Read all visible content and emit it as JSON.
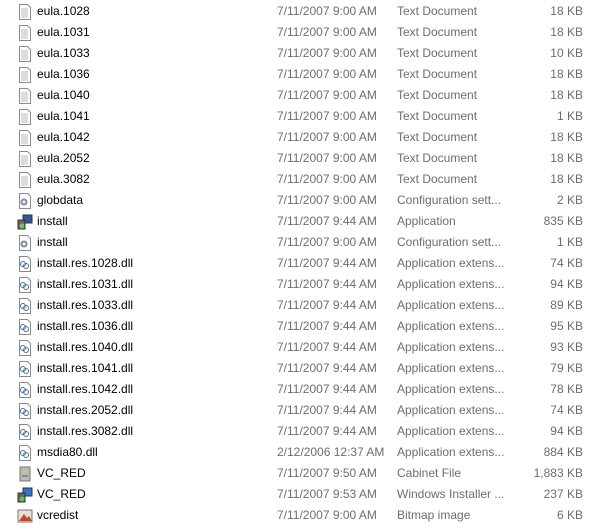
{
  "files": [
    {
      "name": "eula.1028",
      "date": "7/11/2007 9:00 AM",
      "type": "Text Document",
      "size": "18 KB",
      "icon": "text-document"
    },
    {
      "name": "eula.1031",
      "date": "7/11/2007 9:00 AM",
      "type": "Text Document",
      "size": "18 KB",
      "icon": "text-document"
    },
    {
      "name": "eula.1033",
      "date": "7/11/2007 9:00 AM",
      "type": "Text Document",
      "size": "10 KB",
      "icon": "text-document"
    },
    {
      "name": "eula.1036",
      "date": "7/11/2007 9:00 AM",
      "type": "Text Document",
      "size": "18 KB",
      "icon": "text-document"
    },
    {
      "name": "eula.1040",
      "date": "7/11/2007 9:00 AM",
      "type": "Text Document",
      "size": "18 KB",
      "icon": "text-document"
    },
    {
      "name": "eula.1041",
      "date": "7/11/2007 9:00 AM",
      "type": "Text Document",
      "size": "1 KB",
      "icon": "text-document"
    },
    {
      "name": "eula.1042",
      "date": "7/11/2007 9:00 AM",
      "type": "Text Document",
      "size": "18 KB",
      "icon": "text-document"
    },
    {
      "name": "eula.2052",
      "date": "7/11/2007 9:00 AM",
      "type": "Text Document",
      "size": "18 KB",
      "icon": "text-document"
    },
    {
      "name": "eula.3082",
      "date": "7/11/2007 9:00 AM",
      "type": "Text Document",
      "size": "18 KB",
      "icon": "text-document"
    },
    {
      "name": "globdata",
      "date": "7/11/2007 9:00 AM",
      "type": "Configuration sett...",
      "size": "2 KB",
      "icon": "config"
    },
    {
      "name": "install",
      "date": "7/11/2007 9:44 AM",
      "type": "Application",
      "size": "835 KB",
      "icon": "installer"
    },
    {
      "name": "install",
      "date": "7/11/2007 9:00 AM",
      "type": "Configuration sett...",
      "size": "1 KB",
      "icon": "config"
    },
    {
      "name": "install.res.1028.dll",
      "date": "7/11/2007 9:44 AM",
      "type": "Application extens...",
      "size": "74 KB",
      "icon": "dll"
    },
    {
      "name": "install.res.1031.dll",
      "date": "7/11/2007 9:44 AM",
      "type": "Application extens...",
      "size": "94 KB",
      "icon": "dll"
    },
    {
      "name": "install.res.1033.dll",
      "date": "7/11/2007 9:44 AM",
      "type": "Application extens...",
      "size": "89 KB",
      "icon": "dll"
    },
    {
      "name": "install.res.1036.dll",
      "date": "7/11/2007 9:44 AM",
      "type": "Application extens...",
      "size": "95 KB",
      "icon": "dll"
    },
    {
      "name": "install.res.1040.dll",
      "date": "7/11/2007 9:44 AM",
      "type": "Application extens...",
      "size": "93 KB",
      "icon": "dll"
    },
    {
      "name": "install.res.1041.dll",
      "date": "7/11/2007 9:44 AM",
      "type": "Application extens...",
      "size": "79 KB",
      "icon": "dll"
    },
    {
      "name": "install.res.1042.dll",
      "date": "7/11/2007 9:44 AM",
      "type": "Application extens...",
      "size": "78 KB",
      "icon": "dll"
    },
    {
      "name": "install.res.2052.dll",
      "date": "7/11/2007 9:44 AM",
      "type": "Application extens...",
      "size": "74 KB",
      "icon": "dll"
    },
    {
      "name": "install.res.3082.dll",
      "date": "7/11/2007 9:44 AM",
      "type": "Application extens...",
      "size": "94 KB",
      "icon": "dll"
    },
    {
      "name": "msdia80.dll",
      "date": "2/12/2006 12:37 AM",
      "type": "Application extens...",
      "size": "884 KB",
      "icon": "dll"
    },
    {
      "name": "VC_RED",
      "date": "7/11/2007 9:50 AM",
      "type": "Cabinet File",
      "size": "1,883 KB",
      "icon": "cabinet"
    },
    {
      "name": "VC_RED",
      "date": "7/11/2007 9:53 AM",
      "type": "Windows Installer ...",
      "size": "237 KB",
      "icon": "msi"
    },
    {
      "name": "vcredist",
      "date": "7/11/2007 9:00 AM",
      "type": "Bitmap image",
      "size": "6 KB",
      "icon": "bitmap"
    }
  ]
}
